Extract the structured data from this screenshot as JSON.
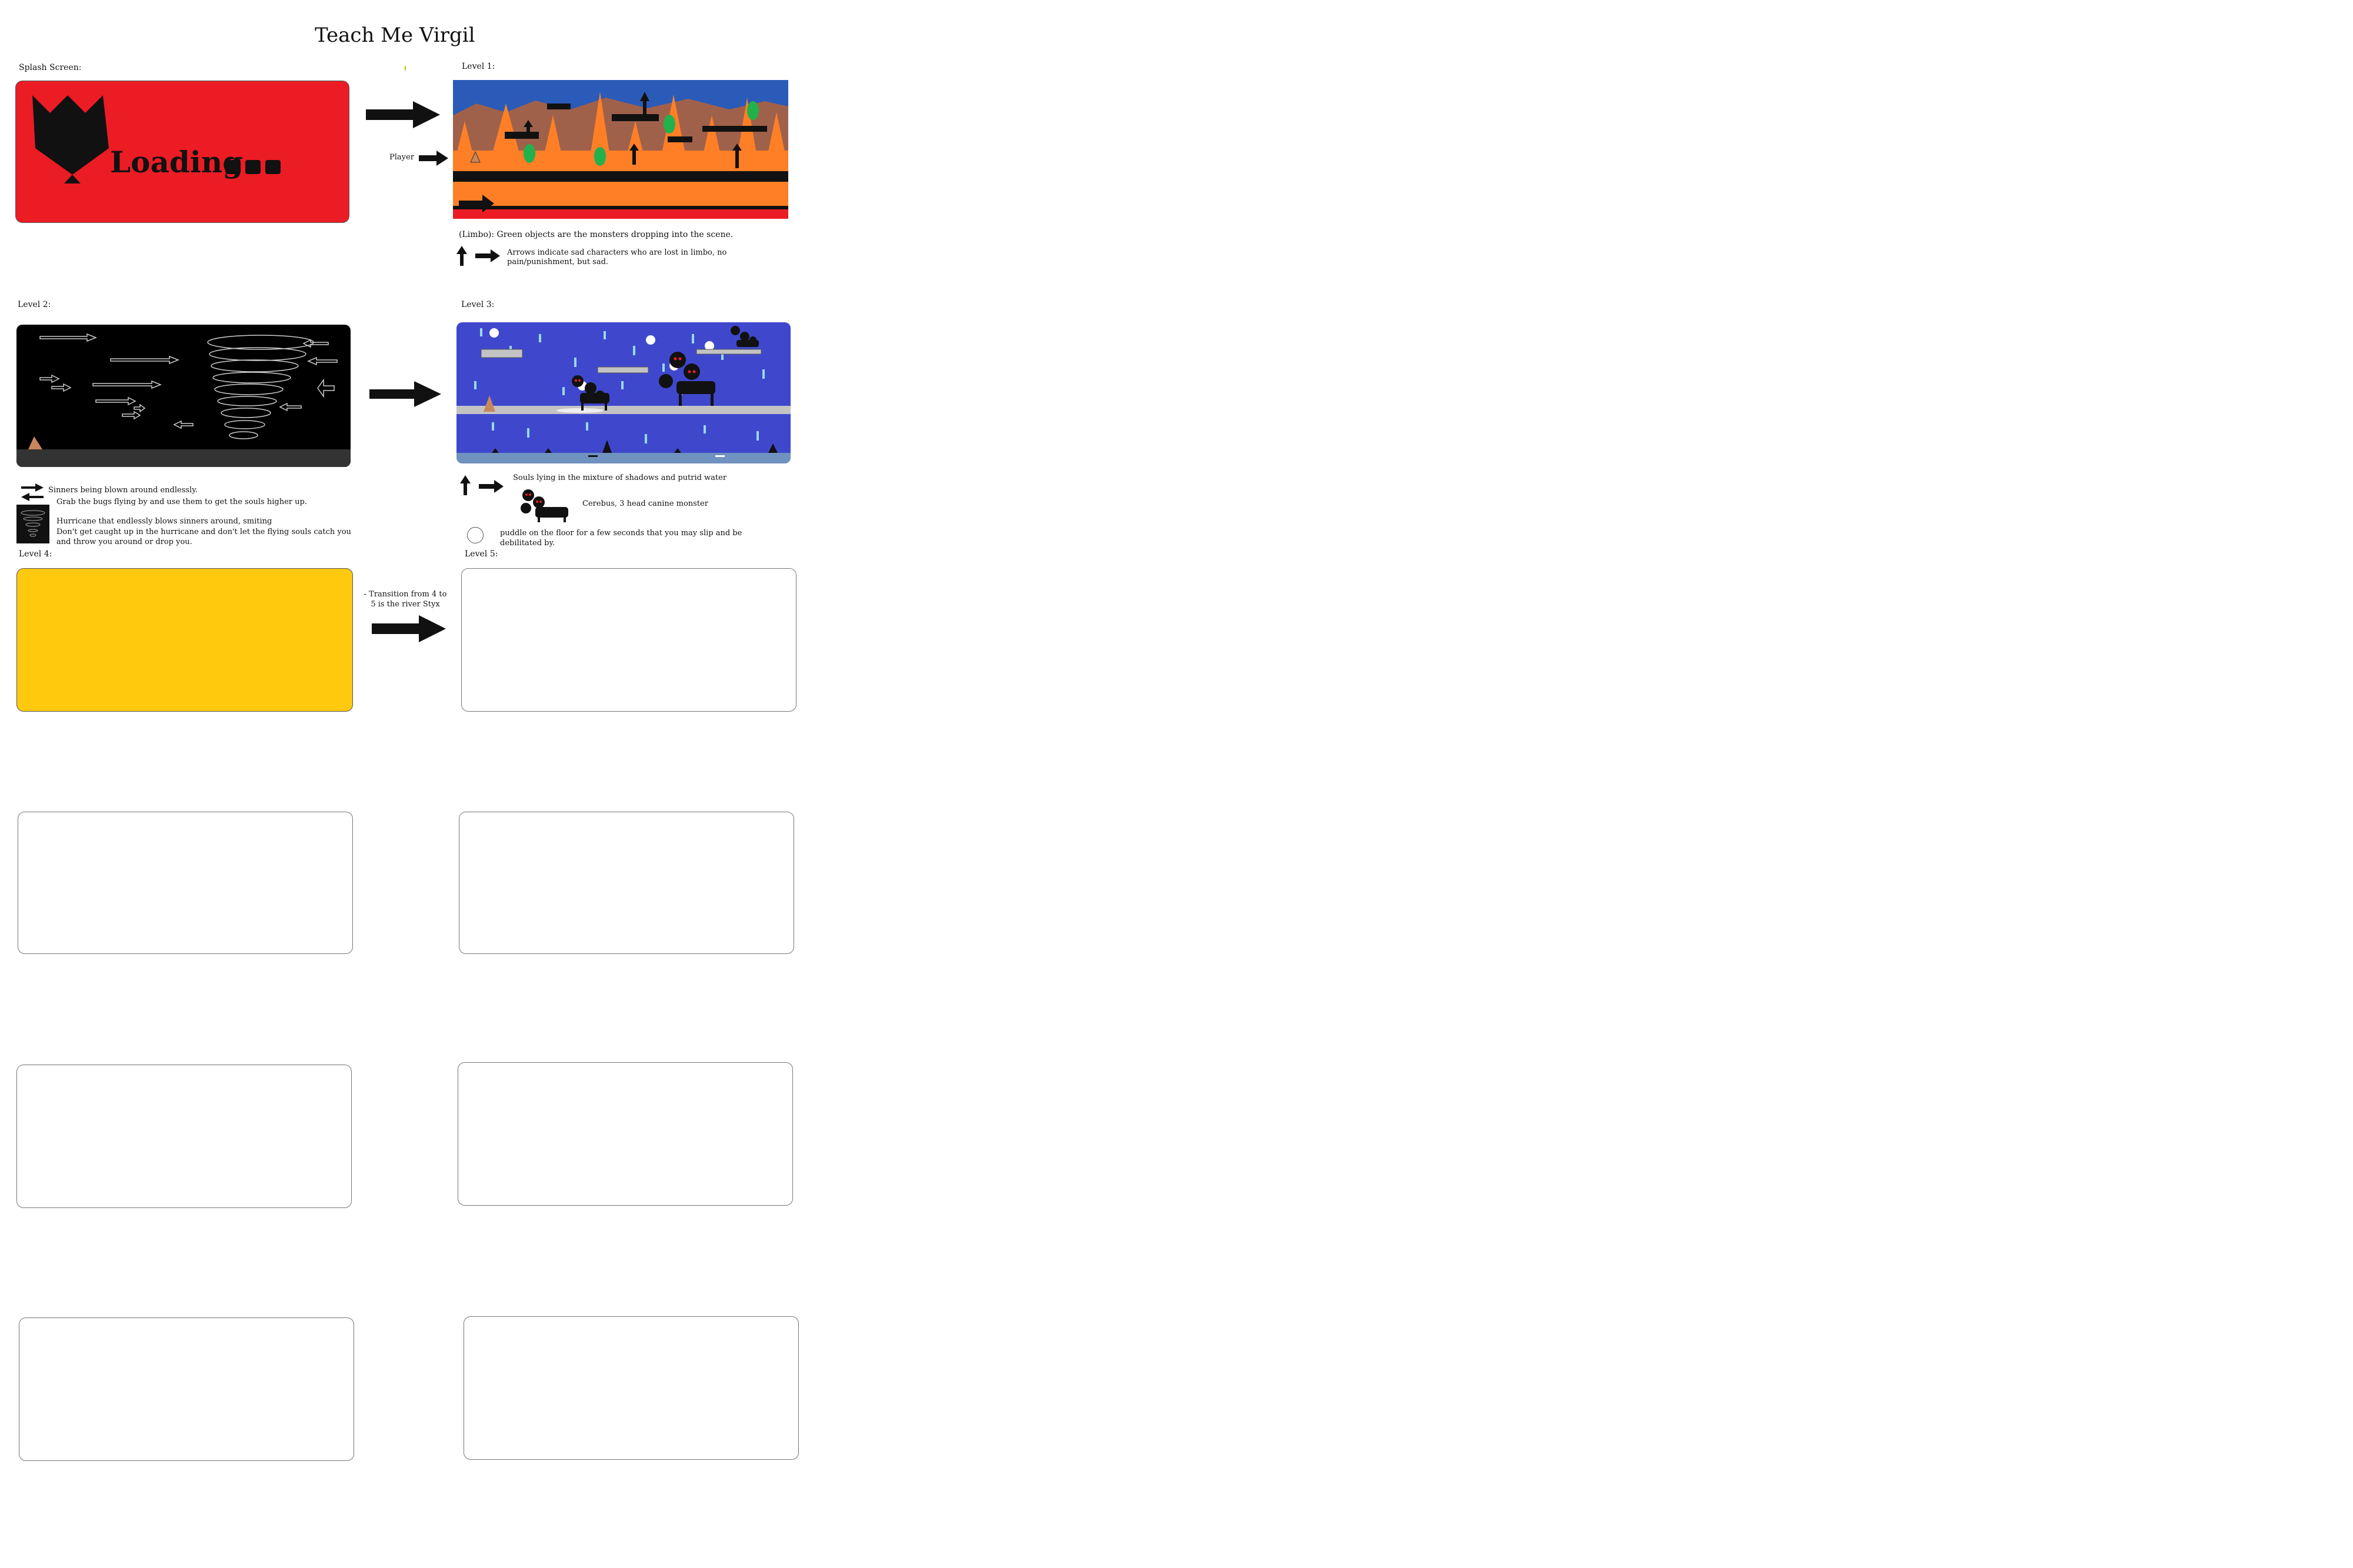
{
  "title": "Teach Me Virgil",
  "splash": {
    "label": "Splash Screen:",
    "loading_text": "Loading"
  },
  "level1": {
    "label": "Level 1:",
    "player_label": "Player",
    "caption": "(Limbo): Green objects are the monsters dropping into the scene.",
    "arrows_note": "Arrows indicate sad characters who are lost in limbo, no pain/punishment, but sad."
  },
  "level2": {
    "label": "Level 2:",
    "note1": "Sinners being blown around endlessly.",
    "note2": "Grab the bugs flying by and use them to get the souls higher up.",
    "note3": "Hurricane that endlessly blows sinners around, smiting",
    "note4": "Don't get caught up in the hurricane and don't let the flying souls catch you and throw you around or drop you."
  },
  "level3": {
    "label": "Level 3:",
    "note1": "Souls lying in the mixture of shadows and putrid water",
    "note2": "Cerebus, 3 head canine monster",
    "note3": "puddle on the floor for a few seconds that you may slip and be debilitated by."
  },
  "level4": {
    "label": "Level 4:",
    "transition_note": "- Transition from 4 to 5 is the river Styx"
  },
  "level5": {
    "label": "Level 5:"
  },
  "colors": {
    "splash_red": "#ec1c24",
    "level4_yellow": "#ffc90e",
    "level3_blue": "#3f48cc",
    "level1_orange": "#ff7f27"
  }
}
